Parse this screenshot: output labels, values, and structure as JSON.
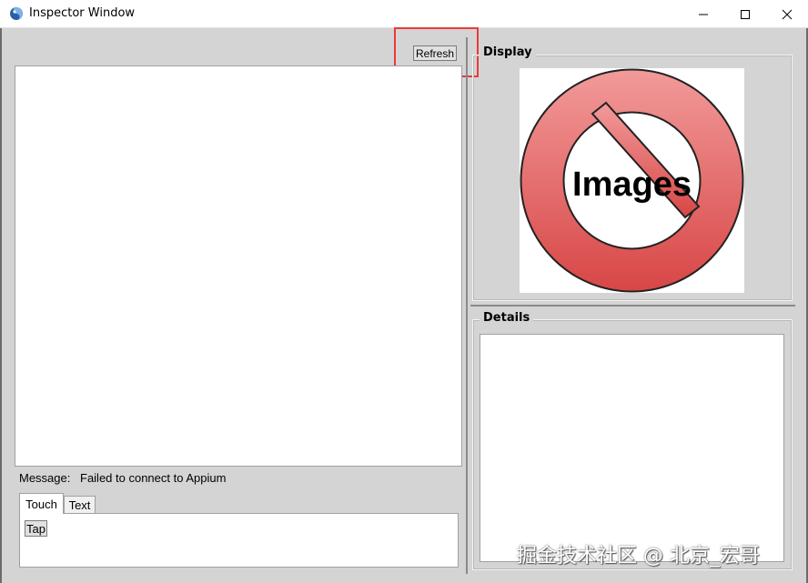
{
  "window": {
    "title": "Inspector Window",
    "controls": [
      "minimize",
      "maximize",
      "close"
    ]
  },
  "toolbar": {
    "refresh_label": "Refresh"
  },
  "message": {
    "label": "Message:",
    "text": "Failed to connect to Appium"
  },
  "tabs": [
    {
      "label": "Touch",
      "selected": true
    },
    {
      "label": "Text",
      "selected": false
    }
  ],
  "touch_panel": {
    "tap_label": "Tap"
  },
  "display": {
    "title": "Display",
    "image_text": "Images"
  },
  "details": {
    "title": "Details"
  },
  "watermark": "掘金技术社区 @ 北京_宏哥",
  "colors": {
    "highlight": "#e83a3a",
    "no_sign_red": "#e05a5a",
    "background": "#d4d4d4"
  }
}
